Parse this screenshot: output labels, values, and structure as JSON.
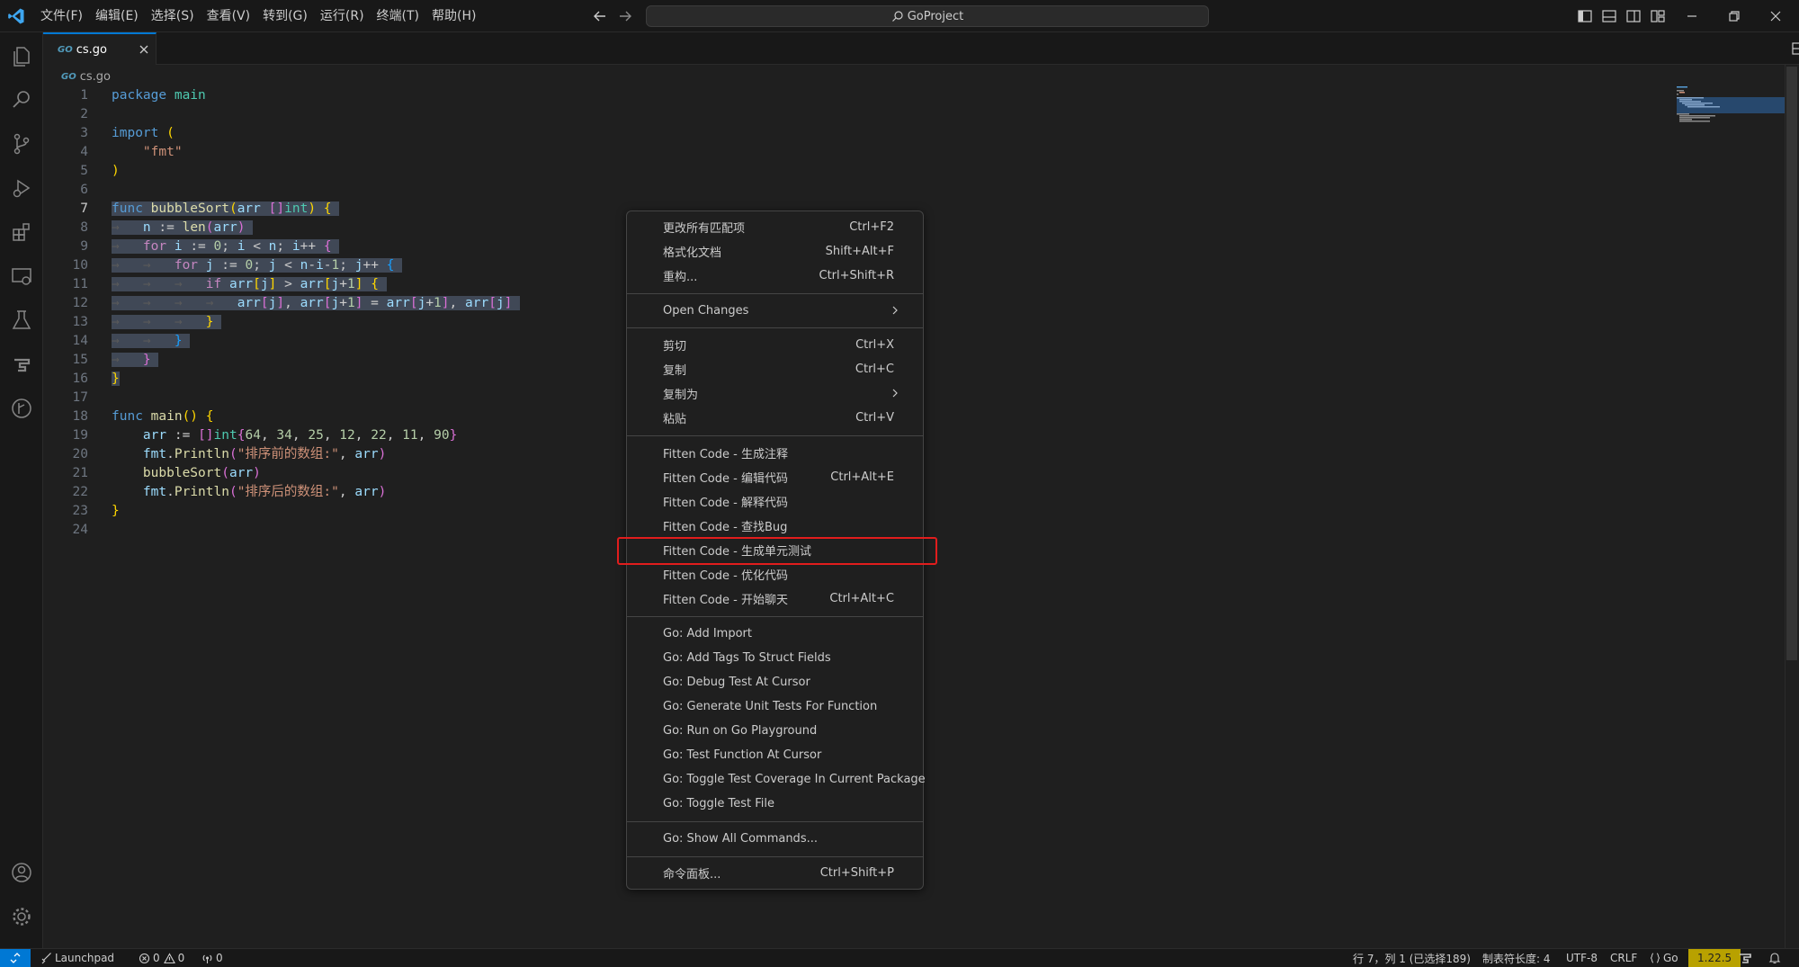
{
  "titlebar": {
    "menu": [
      "文件(F)",
      "编辑(E)",
      "选择(S)",
      "查看(V)",
      "转到(G)",
      "运行(R)",
      "终端(T)",
      "帮助(H)"
    ],
    "search": "GoProject"
  },
  "tab": {
    "label": "cs.go",
    "badge": "GO"
  },
  "breadcrumb": {
    "file": "cs.go"
  },
  "context_menu": {
    "items": [
      {
        "label": "更改所有匹配项",
        "key": "Ctrl+F2"
      },
      {
        "label": "格式化文档",
        "key": "Shift+Alt+F"
      },
      {
        "label": "重构...",
        "key": "Ctrl+Shift+R"
      },
      {
        "label": "Open Changes",
        "key": ""
      },
      {
        "label": "剪切",
        "key": "Ctrl+X"
      },
      {
        "label": "复制",
        "key": "Ctrl+C"
      },
      {
        "label": "复制为",
        "key": ""
      },
      {
        "label": "粘贴",
        "key": "Ctrl+V"
      },
      {
        "label": "Fitten Code - 生成注释",
        "key": ""
      },
      {
        "label": "Fitten Code - 编辑代码",
        "key": "Ctrl+Alt+E"
      },
      {
        "label": "Fitten Code - 解释代码",
        "key": ""
      },
      {
        "label": "Fitten Code - 查找Bug",
        "key": ""
      },
      {
        "label": "Fitten Code - 生成单元测试",
        "key": ""
      },
      {
        "label": "Fitten Code - 优化代码",
        "key": ""
      },
      {
        "label": "Fitten Code - 开始聊天",
        "key": "Ctrl+Alt+C"
      },
      {
        "label": "Go: Add Import",
        "key": ""
      },
      {
        "label": "Go: Add Tags To Struct Fields",
        "key": ""
      },
      {
        "label": "Go: Debug Test At Cursor",
        "key": ""
      },
      {
        "label": "Go: Generate Unit Tests For Function",
        "key": ""
      },
      {
        "label": "Go: Run on Go Playground",
        "key": ""
      },
      {
        "label": "Go: Test Function At Cursor",
        "key": ""
      },
      {
        "label": "Go: Toggle Test Coverage In Current Package",
        "key": ""
      },
      {
        "label": "Go: Toggle Test File",
        "key": ""
      },
      {
        "label": "Go: Show All Commands...",
        "key": ""
      },
      {
        "label": "命令面板...",
        "key": "Ctrl+Shift+P"
      }
    ]
  },
  "statusbar": {
    "launchpad": "Launchpad",
    "errors": "0",
    "warnings": "0",
    "ports": "0",
    "position": "行 7，列 1 (已选择189)",
    "tab_size": "制表符长度: 4",
    "encoding": "UTF-8",
    "eol": "CRLF",
    "language": "Go",
    "go_version": "1.22.5"
  },
  "colors": {
    "accent": "#0078d4",
    "highlight_box": "#e11d1d",
    "go_version_bg": "#b8a100"
  }
}
